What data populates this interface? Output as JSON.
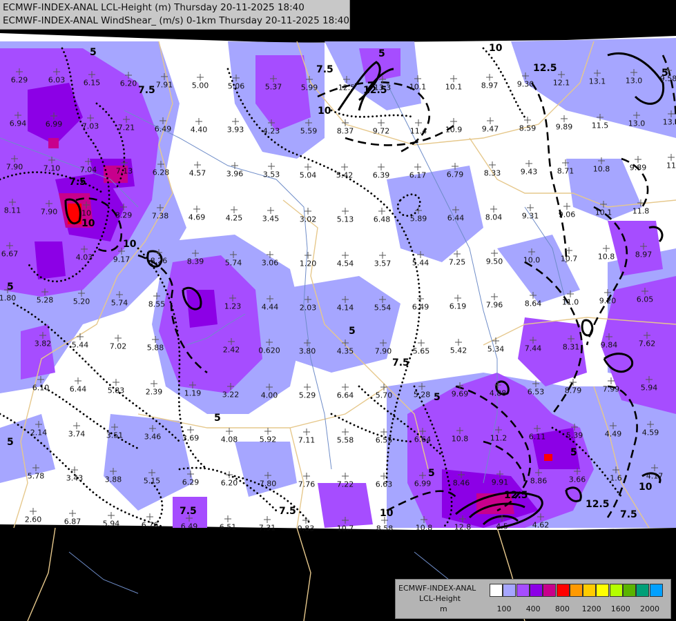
{
  "header": {
    "line1": "ECMWF-INDEX-ANAL LCL-Height (m) Thursday 20-11-2025 18:40",
    "line2": "ECMWF-INDEX-ANAL WindShear_ (m/s) 0-1km Thursday 20-11-2025 18:40"
  },
  "legend": {
    "line1": "ECMWF-INDEX-ANAL",
    "line2": "LCL-Height",
    "line3": "m",
    "colors": [
      "#ffffff",
      "#a6a6ff",
      "#a64dff",
      "#8c00e6",
      "#c8008c",
      "#ff0000",
      "#ff9900",
      "#ffcc00",
      "#ffff00",
      "#b4ff00",
      "#5ab400",
      "#00a078",
      "#00a0ff"
    ],
    "ticks": [
      "100",
      "400",
      "800",
      "1200",
      "1600",
      "2000"
    ]
  },
  "map": {
    "fill_colors": {
      "low": "#a6a6ff",
      "mid": "#a64dff",
      "high": "#8c00e6",
      "very_high": "#c8008c",
      "peak": "#ff0000"
    },
    "border_color": "#e6c88c",
    "contour_labels": [
      "5",
      "7.5",
      "10",
      "12.5"
    ],
    "station_values": [
      {
        "v": "6.29"
      },
      {
        "v": "6.03"
      },
      {
        "v": "6.15"
      },
      {
        "v": "6.20"
      },
      {
        "v": "7.91"
      },
      {
        "v": "5.00"
      },
      {
        "v": "5.06"
      },
      {
        "v": "5.37"
      },
      {
        "v": "5.99"
      },
      {
        "v": "12.5"
      },
      {
        "v": "13.3"
      },
      {
        "v": "10.1"
      },
      {
        "v": "10.1"
      },
      {
        "v": "8.97"
      },
      {
        "v": "9.30"
      },
      {
        "v": "12.1"
      },
      {
        "v": "13.1"
      },
      {
        "v": "13.0"
      },
      {
        "v": "9.58"
      },
      {
        "v": "6.94"
      },
      {
        "v": "6.99"
      },
      {
        "v": "7.03"
      },
      {
        "v": "7.21"
      },
      {
        "v": "6.49"
      },
      {
        "v": "4.40"
      },
      {
        "v": "3.93"
      },
      {
        "v": "4.23"
      },
      {
        "v": "5.59"
      },
      {
        "v": "8.37"
      },
      {
        "v": "9.72"
      },
      {
        "v": "11.4"
      },
      {
        "v": "10.9"
      },
      {
        "v": "9.47"
      },
      {
        "v": "8.59"
      },
      {
        "v": "9.89"
      },
      {
        "v": "11.5"
      },
      {
        "v": "13.0"
      },
      {
        "v": "13.1"
      },
      {
        "v": "7.90"
      },
      {
        "v": "7.10"
      },
      {
        "v": "7.04"
      },
      {
        "v": "7.13"
      },
      {
        "v": "6.28"
      },
      {
        "v": "4.57"
      },
      {
        "v": "3.96"
      },
      {
        "v": "3.53"
      },
      {
        "v": "5.04"
      },
      {
        "v": "5.42"
      },
      {
        "v": "6.39"
      },
      {
        "v": "6.17"
      },
      {
        "v": "6.79"
      },
      {
        "v": "8.33"
      },
      {
        "v": "9.43"
      },
      {
        "v": "8.71"
      },
      {
        "v": "10.8"
      },
      {
        "v": "9.89"
      },
      {
        "v": "11"
      },
      {
        "v": "8.11"
      },
      {
        "v": "7.90"
      },
      {
        "v": "10"
      },
      {
        "v": "8.29"
      },
      {
        "v": "7.38"
      },
      {
        "v": "4.69"
      },
      {
        "v": "4.25"
      },
      {
        "v": "3.45"
      },
      {
        "v": "3.02"
      },
      {
        "v": "5.13"
      },
      {
        "v": "6.48"
      },
      {
        "v": "5.89"
      },
      {
        "v": "6.44"
      },
      {
        "v": "8.04"
      },
      {
        "v": "9.31"
      },
      {
        "v": "9.06"
      },
      {
        "v": "10.1"
      },
      {
        "v": "11.8"
      },
      {
        "v": "6.67"
      },
      {
        "v": "4.03"
      },
      {
        "v": "9.17"
      },
      {
        "v": "8.26"
      },
      {
        "v": "8.39"
      },
      {
        "v": "5.74"
      },
      {
        "v": "3.06"
      },
      {
        "v": "1.20"
      },
      {
        "v": "4.54"
      },
      {
        "v": "3.57"
      },
      {
        "v": "5.44"
      },
      {
        "v": "7.25"
      },
      {
        "v": "9.50"
      },
      {
        "v": "10.0"
      },
      {
        "v": "10.7"
      },
      {
        "v": "10.8"
      },
      {
        "v": "8.97"
      },
      {
        "v": "1.80"
      },
      {
        "v": "5.28"
      },
      {
        "v": "5.20"
      },
      {
        "v": "5.74"
      },
      {
        "v": "8.55"
      },
      {
        "v": "1.23"
      },
      {
        "v": "4.44"
      },
      {
        "v": "2.03"
      },
      {
        "v": "4.14"
      },
      {
        "v": "5.54"
      },
      {
        "v": "6.49"
      },
      {
        "v": "6.19"
      },
      {
        "v": "7.96"
      },
      {
        "v": "8.64"
      },
      {
        "v": "11.0"
      },
      {
        "v": "9.20"
      },
      {
        "v": "6.05"
      },
      {
        "v": "3.82"
      },
      {
        "v": "5.44"
      },
      {
        "v": "7.02"
      },
      {
        "v": "5.88"
      },
      {
        "v": "2.42"
      },
      {
        "v": "0.620"
      },
      {
        "v": "3.80"
      },
      {
        "v": "4.35"
      },
      {
        "v": "7.90"
      },
      {
        "v": "5.65"
      },
      {
        "v": "5.42"
      },
      {
        "v": "5.34"
      },
      {
        "v": "7.44"
      },
      {
        "v": "8.31"
      },
      {
        "v": "9.84"
      },
      {
        "v": "7.62"
      },
      {
        "v": "6.10"
      },
      {
        "v": "6.44"
      },
      {
        "v": "5.83"
      },
      {
        "v": "2.39"
      },
      {
        "v": "1.19"
      },
      {
        "v": "3.22"
      },
      {
        "v": "4.00"
      },
      {
        "v": "5.29"
      },
      {
        "v": "6.64"
      },
      {
        "v": "5.70"
      },
      {
        "v": "5.28"
      },
      {
        "v": "9.69"
      },
      {
        "v": "4.88"
      },
      {
        "v": "6.53"
      },
      {
        "v": "8.79"
      },
      {
        "v": "7.99"
      },
      {
        "v": "5.94"
      },
      {
        "v": "2.14"
      },
      {
        "v": "3.74"
      },
      {
        "v": "3.51"
      },
      {
        "v": "3.46"
      },
      {
        "v": "3.69"
      },
      {
        "v": "4.08"
      },
      {
        "v": "5.92"
      },
      {
        "v": "7.11"
      },
      {
        "v": "5.58"
      },
      {
        "v": "6.55"
      },
      {
        "v": "6.64"
      },
      {
        "v": "10.8"
      },
      {
        "v": "11.2"
      },
      {
        "v": "6.11"
      },
      {
        "v": "5.39"
      },
      {
        "v": "4.49"
      },
      {
        "v": "4.59"
      },
      {
        "v": "5.78"
      },
      {
        "v": "3.43"
      },
      {
        "v": "3.88"
      },
      {
        "v": "5.15"
      },
      {
        "v": "6.29"
      },
      {
        "v": "6.20"
      },
      {
        "v": "7.80"
      },
      {
        "v": "7.76"
      },
      {
        "v": "7.22"
      },
      {
        "v": "6.63"
      },
      {
        "v": "6.99"
      },
      {
        "v": "8.46"
      },
      {
        "v": "9.91"
      },
      {
        "v": "8.86"
      },
      {
        "v": "3.66"
      },
      {
        "v": "1.6"
      },
      {
        "v": "4.17"
      },
      {
        "v": "2.60"
      },
      {
        "v": "6.87"
      },
      {
        "v": "5.94"
      },
      {
        "v": "6.76"
      },
      {
        "v": "6.49"
      },
      {
        "v": "6.51"
      },
      {
        "v": "7.31"
      },
      {
        "v": "9.83"
      },
      {
        "v": "10.7"
      },
      {
        "v": "8.58"
      },
      {
        "v": "10.8"
      },
      {
        "v": "12.8"
      },
      {
        "v": "4.5"
      },
      {
        "v": "4.62"
      }
    ]
  }
}
